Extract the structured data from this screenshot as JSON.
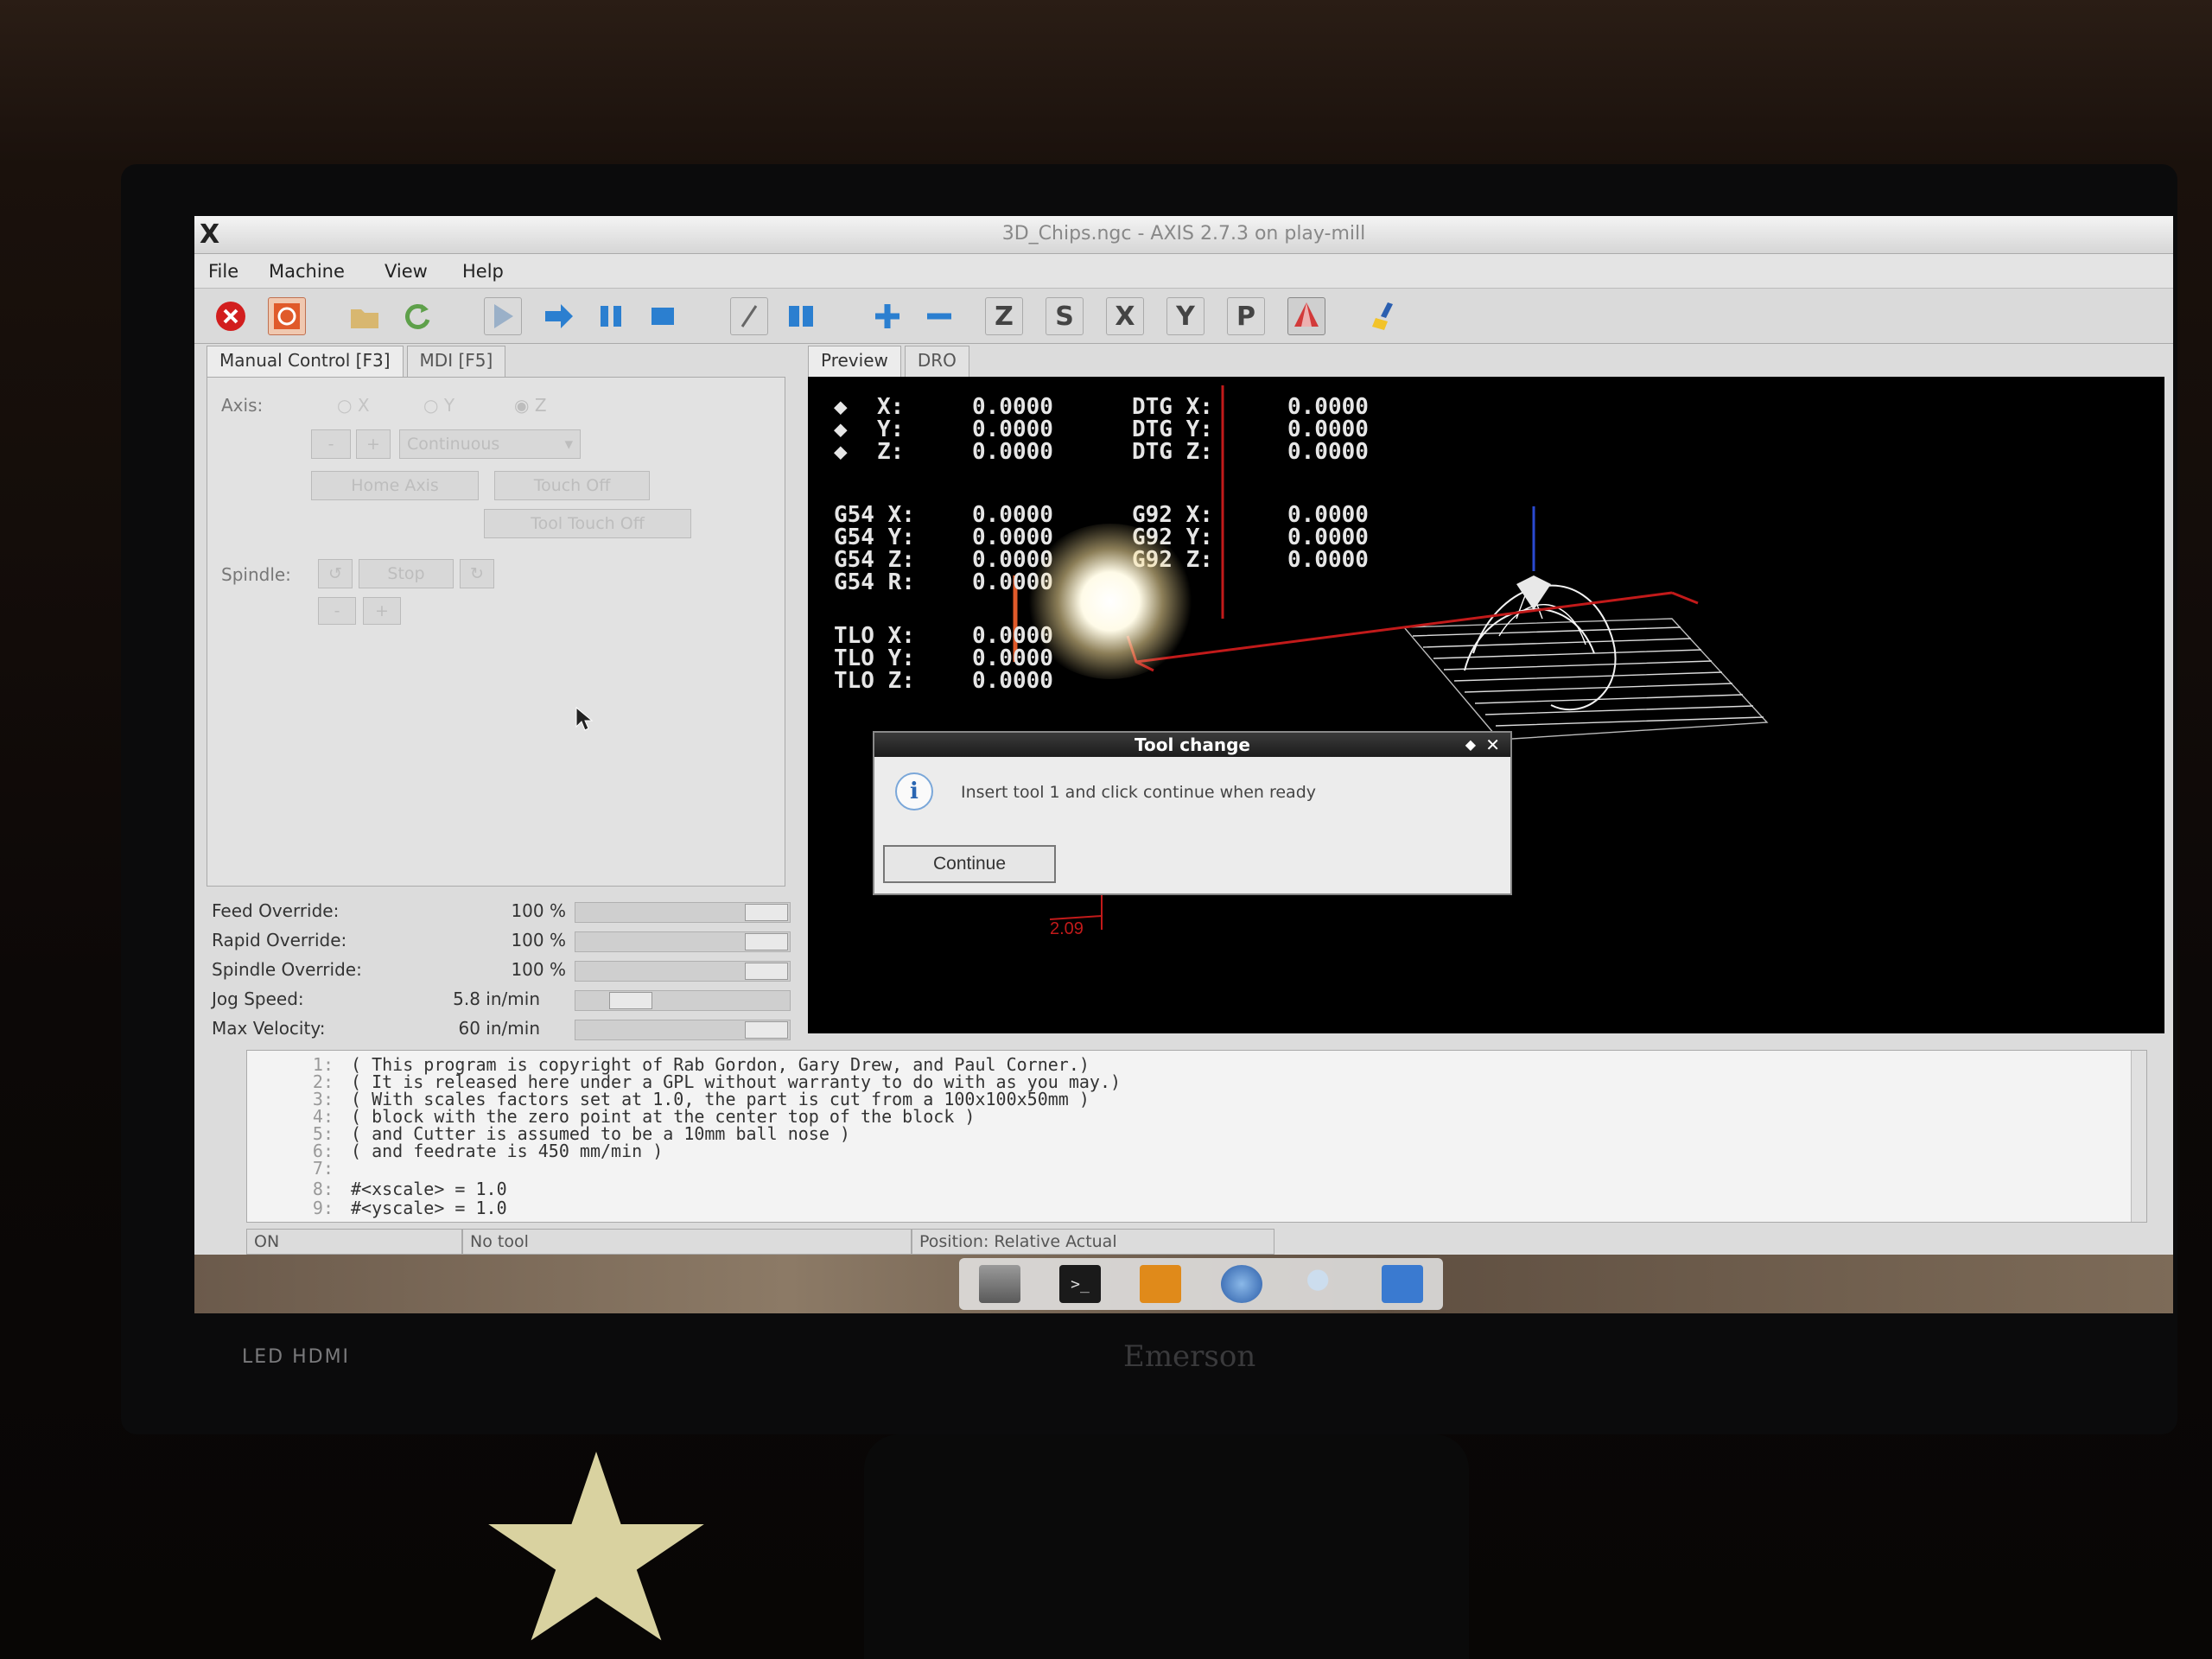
{
  "window": {
    "title": "3D_Chips.ngc - AXIS 2.7.3 on play-mill"
  },
  "menus": [
    "File",
    "Machine",
    "View",
    "Help"
  ],
  "toolbar": {
    "touch_z": "Z",
    "touch_s": "S",
    "view_x": "X",
    "view_y": "Y",
    "view_p": "P"
  },
  "left_tabs": [
    "Manual Control [F3]",
    "MDI [F5]"
  ],
  "manual": {
    "axis_label": "Axis:",
    "axis_options": [
      "X",
      "Y",
      "Z"
    ],
    "jog_minus": "-",
    "jog_plus": "+",
    "jog_mode": "Continuous",
    "home_axis": "Home Axis",
    "touch_off": "Touch Off",
    "tool_touch_off": "Tool Touch Off",
    "spindle_label": "Spindle:",
    "spindle_stop": "Stop",
    "spindle_minus": "-",
    "spindle_plus": "+"
  },
  "overrides": [
    {
      "name": "Feed Override:",
      "value": "100 %",
      "level": 1.0
    },
    {
      "name": "Rapid Override:",
      "value": "100 %",
      "level": 1.0
    },
    {
      "name": "Spindle Override:",
      "value": "100 %",
      "level": 1.0
    },
    {
      "name": "Jog Speed:",
      "value": "5.8 in/min",
      "level": 0.2
    },
    {
      "name": "Max Velocity:",
      "value": "60 in/min",
      "level": 1.0
    }
  ],
  "right_tabs": [
    "Preview",
    "DRO"
  ],
  "dro": {
    "pos": [
      "X:",
      "Y:",
      "Z:"
    ],
    "pos_vals": [
      "0.0000",
      "0.0000",
      "0.0000"
    ],
    "dtg": [
      "DTG X:",
      "DTG Y:",
      "DTG Z:"
    ],
    "dtg_vals": [
      "0.0000",
      "0.0000",
      "0.0000"
    ],
    "g54": [
      "G54 X:",
      "G54 Y:",
      "G54 Z:",
      "G54 R:"
    ],
    "g54_vals": [
      "0.0000",
      "0.0000",
      "0.0000",
      "0.0000"
    ],
    "g92": [
      "G92 X:",
      "G92 Y:",
      "G92 Z:"
    ],
    "g92_vals": [
      "0.0000",
      "0.0000",
      "0.0000"
    ],
    "tlo": [
      "TLO X:",
      "TLO Y:",
      "TLO Z:"
    ],
    "tlo_vals": [
      "0.0000",
      "0.0000",
      "0.0000"
    ]
  },
  "preview_dimension": "2.09",
  "dialog": {
    "title": "Tool change",
    "message": "Insert tool 1 and click continue when ready",
    "button": "Continue"
  },
  "gcode": [
    {
      "n": "1:",
      "text": "( This program is copyright of Rab Gordon, Gary Drew, and Paul Corner.)"
    },
    {
      "n": "2:",
      "text": "( It is released here under a GPL without warranty to do with as you may.)"
    },
    {
      "n": "3:",
      "text": "( With scales factors set at 1.0, the part is cut from a 100x100x50mm )"
    },
    {
      "n": "4:",
      "text": "( block with the zero point at the center top of the block )"
    },
    {
      "n": "5:",
      "text": "( and Cutter is assumed to be a 10mm ball nose )"
    },
    {
      "n": "6:",
      "text": "( and feedrate is 450 mm/min )"
    },
    {
      "n": "7:",
      "text": ""
    },
    {
      "n": "8:",
      "text": "#<xscale> = 1.0"
    },
    {
      "n": "9:",
      "text": "#<yscale> = 1.0"
    }
  ],
  "status": {
    "state": "ON",
    "tool": "No tool",
    "position": "Position: Relative Actual"
  },
  "monitor": {
    "brand": "Emerson",
    "badge": "LED HDMI"
  },
  "colors": {
    "preview_bg": "#000000",
    "toolpath": "#e0e0e0",
    "rapid": "#c21a1a",
    "dialog_title": "#1c1c1c"
  }
}
